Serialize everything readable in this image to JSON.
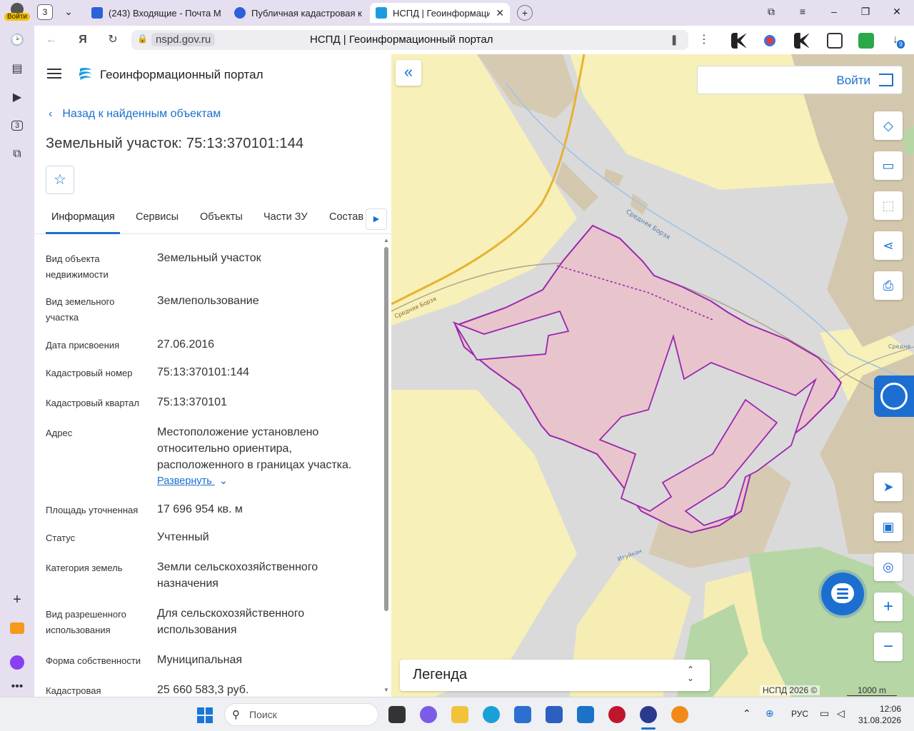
{
  "browser": {
    "profile_label": "Войти",
    "tab_count": "3",
    "tabs": [
      {
        "title": "(243) Входящие - Почта М"
      },
      {
        "title": "Публичная кадастровая к"
      },
      {
        "title": "НСПД | Геоинформаци"
      }
    ],
    "url_host": "nspd.gov.ru",
    "page_title": "НСПД | Геоинформационный портал",
    "rail_badge": "3",
    "downloads_badge": "9"
  },
  "panel": {
    "portal_name": "Геоинформационный портал",
    "back_link": "Назад к найденным объектам",
    "object_title": "Земельный участок: 75:13:370101:144",
    "tabs": [
      {
        "label": "Информация"
      },
      {
        "label": "Сервисы"
      },
      {
        "label": "Объекты"
      },
      {
        "label": "Части ЗУ"
      },
      {
        "label": "Состав"
      }
    ],
    "properties": [
      {
        "label": "Вид объекта недвижимости",
        "value": "Земельный участок"
      },
      {
        "label": "Вид земельного участка",
        "value": "Землепользование"
      },
      {
        "label": "Дата присвоения",
        "value": "27.06.2016"
      },
      {
        "label": "Кадастровый номер",
        "value": "75:13:370101:144"
      },
      {
        "label": "Кадастровый квартал",
        "value": "75:13:370101"
      },
      {
        "label": "Адрес",
        "value": "Местоположение установлено относительно ориентира, расположенного в границах участка."
      },
      {
        "label": "Площадь уточненная",
        "value": "17 696 954 кв. м"
      },
      {
        "label": "Статус",
        "value": "Учтенный"
      },
      {
        "label": "Категория земель",
        "value": "Земли сельскохозяйственного назначения"
      },
      {
        "label": "Вид разрешенного использования",
        "value": "Для сельскохозяйственного использования"
      },
      {
        "label": "Форма собственности",
        "value": "Муниципальная"
      },
      {
        "label": "Кадастровая",
        "value": "25 660 583,3 руб."
      }
    ],
    "expand_label": "Развернуть"
  },
  "map": {
    "login_label": "Войти",
    "legend_label": "Легенда",
    "copyright": "НСПД 2026 ©",
    "scale": "1000 m",
    "river_label": "Средняя Борзя",
    "river_label_2": "Средняя Борзя",
    "river_label_3": "Средня",
    "stream_label": "Итуйкан",
    "parcel_color": "#9b27af",
    "parcel_fill": "#e8c4cc"
  },
  "taskbar": {
    "search_placeholder": "Поиск",
    "language": "РУС",
    "time": "12:06",
    "date": "31.08.2026"
  }
}
